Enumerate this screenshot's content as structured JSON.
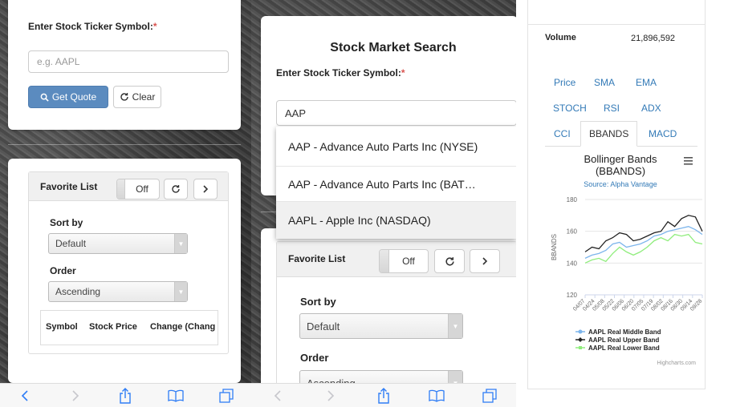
{
  "panel1": {
    "ticker_label": "Enter Stock Ticker Symbol:",
    "required_mark": "*",
    "input_placeholder": "e.g. AAPL",
    "get_quote_label": "Get Quote",
    "clear_label": "Clear",
    "favorite": {
      "title": "Favorite List",
      "toggle_label": "Off",
      "sort_by_label": "Sort by",
      "sort_by_value": "Default",
      "order_label": "Order",
      "order_value": "Ascending",
      "columns": [
        "Symbol",
        "Stock Price",
        "Change (Chang"
      ]
    }
  },
  "panel2": {
    "title": "Stock Market Search",
    "ticker_label": "Enter Stock Ticker Symbol:",
    "required_mark": "*",
    "input_value": "AAP",
    "suggestions": [
      "AAP - Advance Auto Parts Inc (NYSE)",
      "AAP - Advance Auto Parts Inc (BAT…",
      "AAPL - Apple Inc (NASDAQ)"
    ],
    "favorite": {
      "title": "Favorite List",
      "toggle_label": "Off",
      "sort_by_label": "Sort by",
      "sort_by_value": "Default",
      "order_label": "Order",
      "order_value": "Ascending"
    }
  },
  "panel3": {
    "volume_label": "Volume",
    "volume_value": "21,896,592",
    "tabs_row1": [
      "Price",
      "SMA",
      "EMA"
    ],
    "tabs_row2": [
      "STOCH",
      "RSI",
      "ADX"
    ],
    "tabs_row3": [
      "CCI",
      "BBANDS",
      "MACD"
    ],
    "active_tab": "BBANDS",
    "credit": "Highcharts.com"
  },
  "colors": {
    "link": "#337ab7",
    "primary": "#5b8bbf",
    "required": "#d9534f",
    "middle_band": "#7cb5ec",
    "upper_band": "#222222",
    "lower_band": "#90ed7d"
  },
  "chart_data": {
    "type": "line",
    "title": "Bollinger Bands",
    "title_line2": "(BBANDS)",
    "subtitle": "Source: Alpha Vantage",
    "ylabel": "BBANDS",
    "ylim": [
      120,
      180
    ],
    "yticks": [
      "180",
      "160",
      "140",
      "120"
    ],
    "categories": [
      "04/07",
      "04/24",
      "05/08",
      "05/22",
      "06/06",
      "06/20",
      "07/05",
      "07/19",
      "08/02",
      "08/16",
      "08/30",
      "09/14",
      "09/28"
    ],
    "series": [
      {
        "name": "AAPL Real Middle Band",
        "color": "#7cb5ec",
        "values": [
          143,
          145,
          146,
          148,
          152,
          153,
          150,
          151,
          152,
          154,
          157,
          158,
          160,
          161,
          162,
          163,
          161,
          158
        ]
      },
      {
        "name": "AAPL Real Upper Band",
        "color": "#222222",
        "values": [
          147,
          150,
          149,
          154,
          156,
          159,
          158,
          154,
          155,
          157,
          159,
          160,
          166,
          163,
          168,
          170,
          169,
          160
        ]
      },
      {
        "name": "AAPL Real Lower Band",
        "color": "#90ed7d",
        "values": [
          140,
          142,
          143,
          141,
          146,
          150,
          147,
          145,
          147,
          150,
          154,
          156,
          154,
          158,
          157,
          158,
          153,
          152
        ]
      }
    ]
  }
}
